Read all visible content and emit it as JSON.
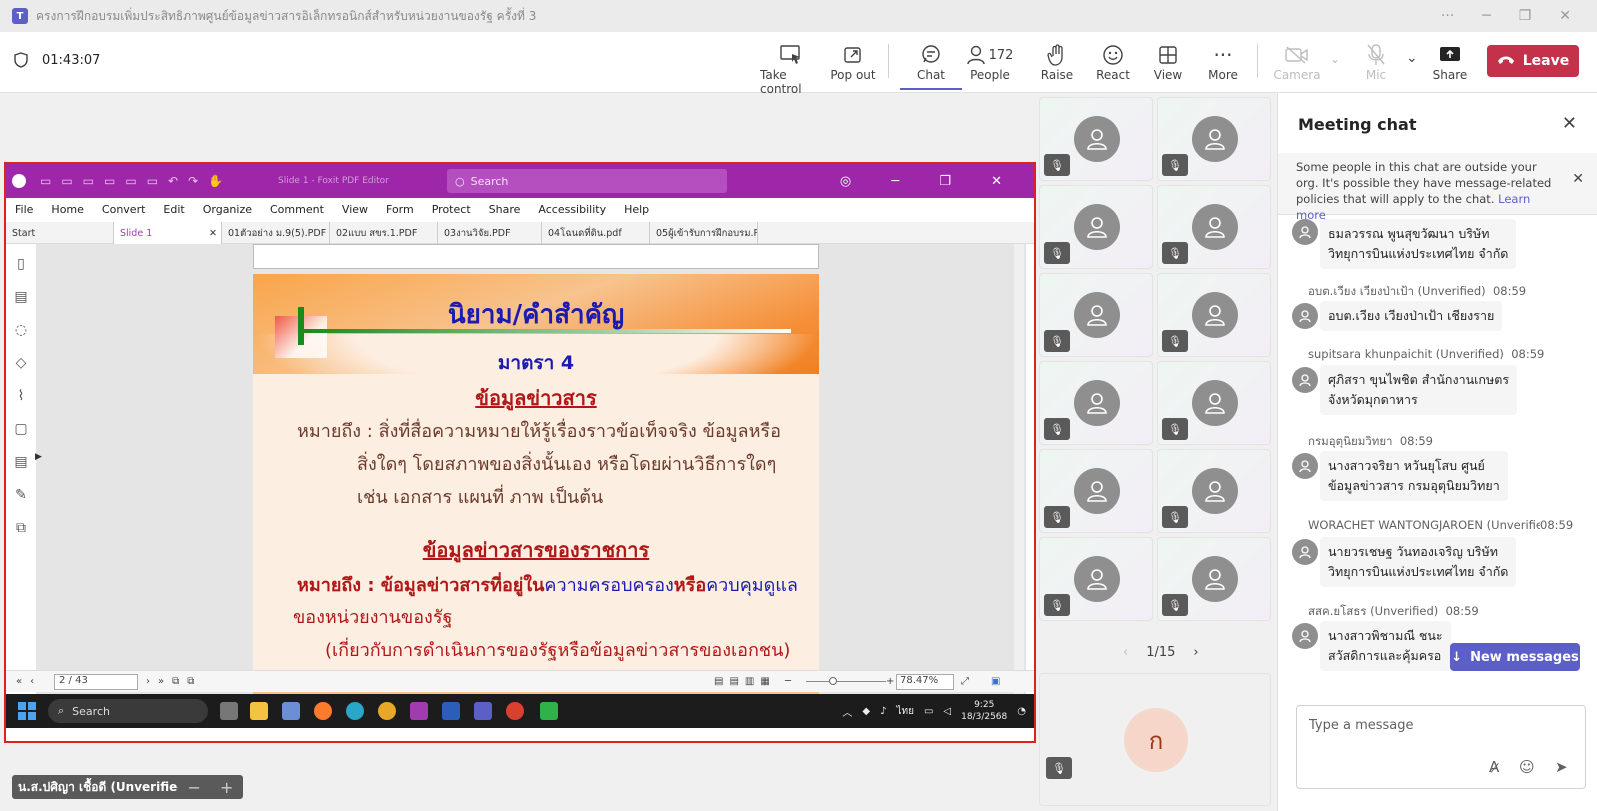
{
  "window": {
    "title": "ครงการฝึกอบรมเพิ่มประสิทธิภาพศูนย์ข้อมูลข่าวสารอิเล็กทรอนิกส์สำหรับหน่วยงานของรัฐ ครั้งที่ 3",
    "logo": "T"
  },
  "meeting": {
    "timer": "01:43:07"
  },
  "toolbar": {
    "take_control": "Take control",
    "pop_out": "Pop out",
    "chat": "Chat",
    "people": "People",
    "people_count": "172",
    "raise": "Raise",
    "react": "React",
    "view": "View",
    "more": "More",
    "camera": "Camera",
    "mic": "Mic",
    "share": "Share",
    "leave": "Leave"
  },
  "pdf": {
    "app_title": "Slide 1 - Foxit PDF Editor",
    "search_placeholder": "Search",
    "menu": [
      "File",
      "Home",
      "Convert",
      "Edit",
      "Organize",
      "Comment",
      "View",
      "Form",
      "Protect",
      "Share",
      "Accessibility",
      "Help"
    ],
    "tabs": [
      "Start",
      "Slide 1",
      "01ตัวอย่าง ม.9(5).PDF",
      "02แบบ สขร.1.PDF",
      "03งานวิจัย.PDF",
      "04โฉนดที่ดิน.pdf",
      "05ผู้เข้ารับการฝึกอบรม.PDF"
    ],
    "page_indicator": "2 / 43",
    "zoom": "78.47%"
  },
  "slide": {
    "title": "นิยาม/คำสำคัญ",
    "section": "มาตรา 4",
    "heading1": "ข้อมูลข่าวสาร",
    "body1_line1": "หมายถึง : สิ่งที่สื่อความหมายให้รู้เรื่องราวข้อเท็จจริง ข้อมูลหรือ",
    "body1_line2": "สิ่งใดๆ โดยสภาพของสิ่งนั้นเอง หรือโดยผ่านวิธีการใดๆ",
    "body1_line3": "เช่น เอกสาร แผนที่ ภาพ เป็นต้น",
    "heading2": "ข้อมูลข่าวสารของราชการ",
    "body2_prefix": "หมายถึง : ข้อมูลข่าวสารที่อยู่ใน",
    "body2_mid1": "ความครอบครอง",
    "body2_mid2": "หรือ",
    "body2_mid3": "ควบคุมดูแล",
    "body2_line2": "ของหน่วยงานของรัฐ",
    "body2_line3": "(เกี่ยวกับการดำเนินการของรัฐหรือข้อมูลข่าวสารของเอกชน)"
  },
  "taskbar": {
    "search": "Search",
    "lang": "ไทย",
    "time": "9:25",
    "date": "18/3/2568"
  },
  "gallery": {
    "pager": "1/15",
    "self_initial": "ก"
  },
  "chat": {
    "title": "Meeting chat",
    "notice": "Some people in this chat are outside your org. It's possible they have message-related policies that will apply to the chat.",
    "notice_link": "Learn more",
    "messages": [
      {
        "sender": "",
        "time": "",
        "text1": "ธมลวรรณ พูนสุขวัฒนา บริษัท",
        "text2": "วิทยุการบินแห่งประเทศไทย จำกัด"
      },
      {
        "sender": "อบต.เวียง เวียงป่าเป้า (Unverified)",
        "time": "08:59",
        "text1": "อบต.เวียง เวียงป่าเป้า เชียงราย",
        "text2": ""
      },
      {
        "sender": "supitsara khunpaichit (Unverified)",
        "time": "08:59",
        "text1": "ศุภิสรา ขุนไพชิต สำนักงานเกษตร",
        "text2": "จังหวัดมุกดาหาร"
      },
      {
        "sender": "กรมอุตุนิยมวิทยา",
        "time": "08:59",
        "text1": "นางสาวจริยา หวันยุโสบ ศูนย์",
        "text2": "ข้อมูลข่าวสาร กรมอุตุนิยมวิทยา"
      },
      {
        "sender": "WORACHET WANTONGJAROEN (Unverified)",
        "time": "08:59",
        "text1": "นายวรเชษฐ วันทองเจริญ บริษัท",
        "text2": "วิทยุการบินแห่งประเทศไทย จำกัด"
      },
      {
        "sender": "สสค.ยโสธร (Unverified)",
        "time": "08:59",
        "text1": "นางสาวพิชามณี ชนะ",
        "text2": "สวัสดิการและคุ้มครอ"
      }
    ],
    "new_messages": "New messages",
    "compose_placeholder": "Type a message"
  },
  "presenter": {
    "name": "น.ส.ปศิญา เชื้อดี (Unverified)"
  }
}
